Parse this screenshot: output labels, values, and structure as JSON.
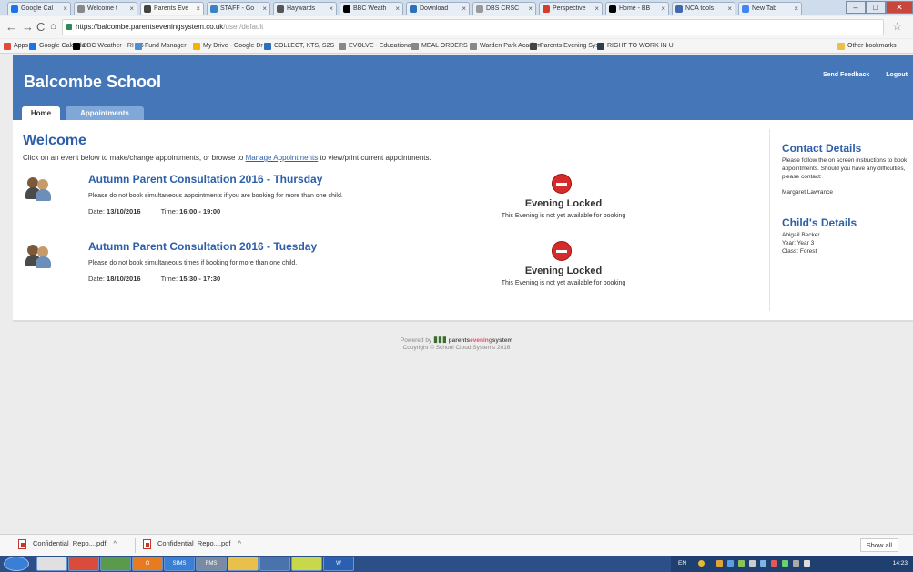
{
  "browser": {
    "tabs": [
      {
        "label": "Google Cal",
        "color": "#1a73e8"
      },
      {
        "label": "Welcome t",
        "color": "#888888"
      },
      {
        "label": "Parents Eve",
        "color": "#444444"
      },
      {
        "label": "STAFF - Go",
        "color": "#3b82c4"
      },
      {
        "label": "Haywards",
        "color": "#555555"
      },
      {
        "label": "BBC Weath",
        "color": "#000000"
      },
      {
        "label": "Download",
        "color": "#2c6fbb"
      },
      {
        "label": "DBS CRSC",
        "color": "#999999"
      },
      {
        "label": "Perspective",
        "color": "#d93b2b"
      },
      {
        "label": "Home - BB",
        "color": "#000000"
      },
      {
        "label": "NCA tools",
        "color": "#4466aa"
      },
      {
        "label": "New Tab",
        "color": "#4285f4"
      }
    ],
    "url_host": "https://balcombe.parentseveningsystem.co.uk",
    "url_path": "/user/default",
    "bookmarks": [
      {
        "label": "Apps",
        "color": "#e04b3a"
      },
      {
        "label": "Google Calendar",
        "color": "#1a73e8"
      },
      {
        "label": "BBC Weather - RH16",
        "color": "#000000"
      },
      {
        "label": "Fund Manager",
        "color": "#4a90d9"
      },
      {
        "label": "My Drive - Google Dr",
        "color": "#f4b400"
      },
      {
        "label": "COLLECT, KTS, S2S",
        "color": "#2c6fbb"
      },
      {
        "label": "EVOLVE - Educationa",
        "color": "#888888"
      },
      {
        "label": "MEAL ORDERS",
        "color": "#888888"
      },
      {
        "label": "Warden Park Academ",
        "color": "#888888"
      },
      {
        "label": "Parents Evening Syste",
        "color": "#444444"
      },
      {
        "label": "RIGHT TO WORK IN U",
        "color": "#2c3e50"
      }
    ],
    "other_bookmarks": "Other bookmarks"
  },
  "header": {
    "school_name": "Balcombe School",
    "send_feedback": "Send Feedback",
    "logout": "Logout",
    "tab_home": "Home",
    "tab_appointments": "Appointments"
  },
  "main": {
    "welcome": "Welcome",
    "intro_before": "Click on an event below to make/change appointments, or browse to ",
    "intro_link": "Manage Appointments",
    "intro_after": " to view/print current appointments.",
    "events": [
      {
        "title": "Autumn Parent Consultation 2016 - Thursday",
        "note": "Please do not book simultaneous appointments if you are booking for more than one child.",
        "date_label": "Date:",
        "date": "13/10/2016",
        "time_label": "Time:",
        "time": "16:00 - 19:00",
        "status_title": "Evening Locked",
        "status_sub": "This Evening is not yet available for booking"
      },
      {
        "title": "Autumn Parent Consultation 2016 - Tuesday",
        "note": "Please do not book simultaneous times if booking for more than one child.",
        "date_label": "Date:",
        "date": "18/10/2016",
        "time_label": "Time:",
        "time": "15:30 - 17:30",
        "status_title": "Evening Locked",
        "status_sub": "This Evening is not yet available for booking"
      }
    ]
  },
  "sidebar": {
    "contact_title": "Contact Details",
    "contact_text": "Please follow the on screen instructions to book appointments. Should you have any difficulties, please contact:",
    "contact_name": "Margaret Lawrance",
    "child_title": "Child's Details",
    "child_name": "Abigail Becker",
    "child_year": "Year: Year 3",
    "child_class": "Class: Forest"
  },
  "footer": {
    "powered_by": "Powered by",
    "brand_a": "parents",
    "brand_b": "evening",
    "brand_c": "system",
    "copyright": "Copyright © School Cloud Systems 2016"
  },
  "downloads": {
    "items": [
      "Confidential_Repo....pdf",
      "Confidential_Repo....pdf"
    ],
    "show_all": "Show all"
  },
  "taskbar": {
    "apps": [
      "",
      "",
      "",
      "O",
      "SIMS",
      "FMS",
      "",
      "",
      "",
      "W"
    ],
    "lang": "EN",
    "clock": "14:23"
  }
}
